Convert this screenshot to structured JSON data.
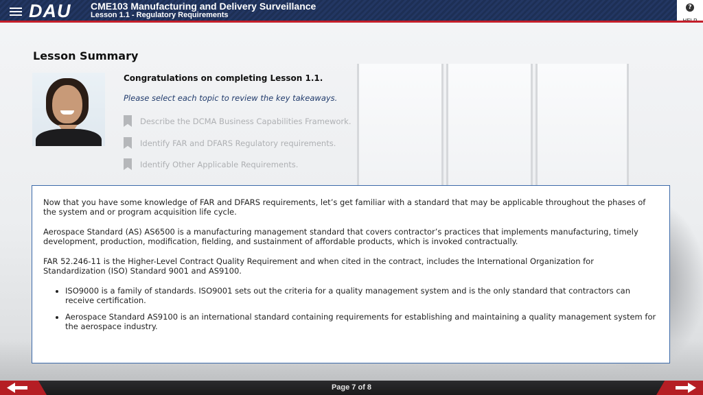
{
  "header": {
    "logo": "DAU",
    "course_title": "CME103 Manufacturing and Delivery Surveillance",
    "lesson_title": "Lesson 1.1 - Regulatory Requirements",
    "help_label": "HELP"
  },
  "summary": {
    "title": "Lesson Summary",
    "congrats": "Congratulations on completing Lesson 1.1.",
    "instruction": "Please select each topic to review the key takeaways.",
    "topics": [
      {
        "label": "Describe the DCMA Business Capabilities Framework."
      },
      {
        "label": "Identify FAR and DFARS Regulatory requirements."
      },
      {
        "label": "Identify Other Applicable Requirements."
      }
    ]
  },
  "content": {
    "paragraphs": [
      "Now that you have some knowledge of FAR and DFARS requirements, let’s get familiar with a standard that may be applicable throughout the phases of the system and or program acquisition life cycle.",
      "Aerospace Standard (AS) AS6500 is a manufacturing management standard that covers contractor’s practices that implements manufacturing, timely development, production, modification, fielding, and sustainment of affordable products, which is invoked contractually.",
      "FAR 52.246-11 is the Higher-Level Contract Quality Requirement and when cited in the contract, includes the International Organization for Standardization (ISO) Standard 9001 and AS9100."
    ],
    "bullets": [
      "ISO9000 is a family of standards. ISO9001 sets out the criteria for a quality management system and is the only standard that contractors can receive certification.",
      "Aerospace Standard AS9100 is an international standard containing requirements for establishing and maintaining a quality management system for the aerospace industry."
    ]
  },
  "footer": {
    "page_indicator": "Page 7 of 8"
  },
  "colors": {
    "header_navy": "#1d2f55",
    "accent_red": "#c41e2a",
    "box_border": "#3a68a8"
  },
  "icons": {
    "menu": "hamburger-icon",
    "help": "question-icon",
    "topic": "bookmark-icon",
    "prev": "arrow-left-icon",
    "next": "arrow-right-icon"
  }
}
